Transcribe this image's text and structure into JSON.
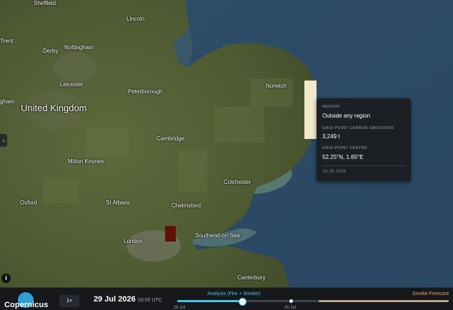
{
  "map": {
    "places": {
      "sheffield": "Sheffield",
      "lincoln": "Lincoln",
      "trent": "Trent",
      "derby": "Derby",
      "nottingham": "Nottingham",
      "leicester": "Leicester",
      "peterborough": "Peterborough",
      "norwich": "Norwich",
      "united_kingdom": "United Kingdom",
      "gham": "gham",
      "cambridge": "Cambridge",
      "milton_keynes": "Milton Keynes",
      "colchester": "Colchester",
      "oxford": "Oxford",
      "st_albans": "St Albans",
      "chelmsford": "Chelmsford",
      "london": "London",
      "southend": "Southend-on-Sea",
      "canterbury": "Canterbury"
    },
    "highlight_color": "#f0e8c8",
    "hotspot_color": "#5f1208"
  },
  "tooltip": {
    "region_label": "REGION",
    "region_value": "Outside any region",
    "emissions_label": "GRID-POINT CARBON EMISSIONS",
    "emissions_value": "3,249 t",
    "centre_label": "GRID-POINT CENTRE",
    "centre_value": "52.25°N, 1.65°E",
    "date": "Jul 29, 2026"
  },
  "controls": {
    "side_toggle": "‹",
    "info": "i",
    "logo": "Copernicus",
    "speed": "1×",
    "date": "29 Jul 2026",
    "time": "03:00 UTC",
    "mode": "Analysis (Fire + Smoke)",
    "forecast": "Smoke Forecast",
    "tick_28": "28 Jul",
    "tick_30": "30 Jul",
    "progress": 0.24,
    "analysis_end": 0.52,
    "accent_color": "#4dc3e6",
    "forecast_color": "#f0a45a"
  }
}
